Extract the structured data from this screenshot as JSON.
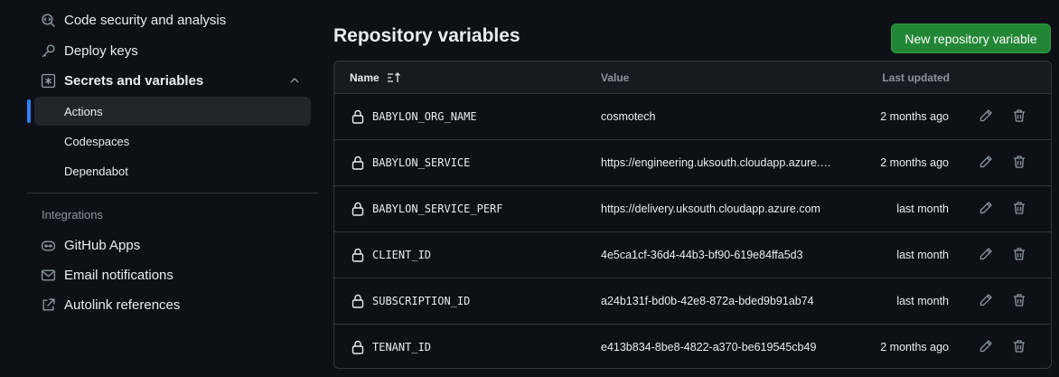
{
  "sidebar": {
    "items": [
      {
        "label": "Code security and analysis",
        "icon": "codescan-icon"
      },
      {
        "label": "Deploy keys",
        "icon": "key-icon"
      },
      {
        "label": "Secrets and variables",
        "icon": "asterisk-icon"
      }
    ],
    "sub_items": [
      {
        "label": "Actions",
        "active": true
      },
      {
        "label": "Codespaces",
        "active": false
      },
      {
        "label": "Dependabot",
        "active": false
      }
    ],
    "integrations_label": "Integrations",
    "integrations": [
      {
        "label": "GitHub Apps",
        "icon": "hubot-icon"
      },
      {
        "label": "Email notifications",
        "icon": "mail-icon"
      },
      {
        "label": "Autolink references",
        "icon": "link-external-icon"
      }
    ]
  },
  "main": {
    "title": "Repository variables",
    "new_button": "New repository variable",
    "table": {
      "headers": {
        "name": "Name",
        "value": "Value",
        "updated": "Last updated"
      },
      "rows": [
        {
          "name": "BABYLON_ORG_NAME",
          "value": "cosmotech",
          "updated": "2 months ago"
        },
        {
          "name": "BABYLON_SERVICE",
          "value": "https://engineering.uksouth.cloudapp.azure.com",
          "updated": "2 months ago"
        },
        {
          "name": "BABYLON_SERVICE_PERF",
          "value": "https://delivery.uksouth.cloudapp.azure.com",
          "updated": "last month"
        },
        {
          "name": "CLIENT_ID",
          "value": "4e5ca1cf-36d4-44b3-bf90-619e84ffa5d3",
          "updated": "last month"
        },
        {
          "name": "SUBSCRIPTION_ID",
          "value": "a24b131f-bd0b-42e8-872a-bded9b91ab74",
          "updated": "last month"
        },
        {
          "name": "TENANT_ID",
          "value": "e413b834-8be8-4822-a370-be619545cb49",
          "updated": "2 months ago"
        }
      ]
    }
  },
  "colors": {
    "accent": "#2f81f7",
    "primary_button": "#238636",
    "background": "#0d1117",
    "border": "#30363d"
  }
}
